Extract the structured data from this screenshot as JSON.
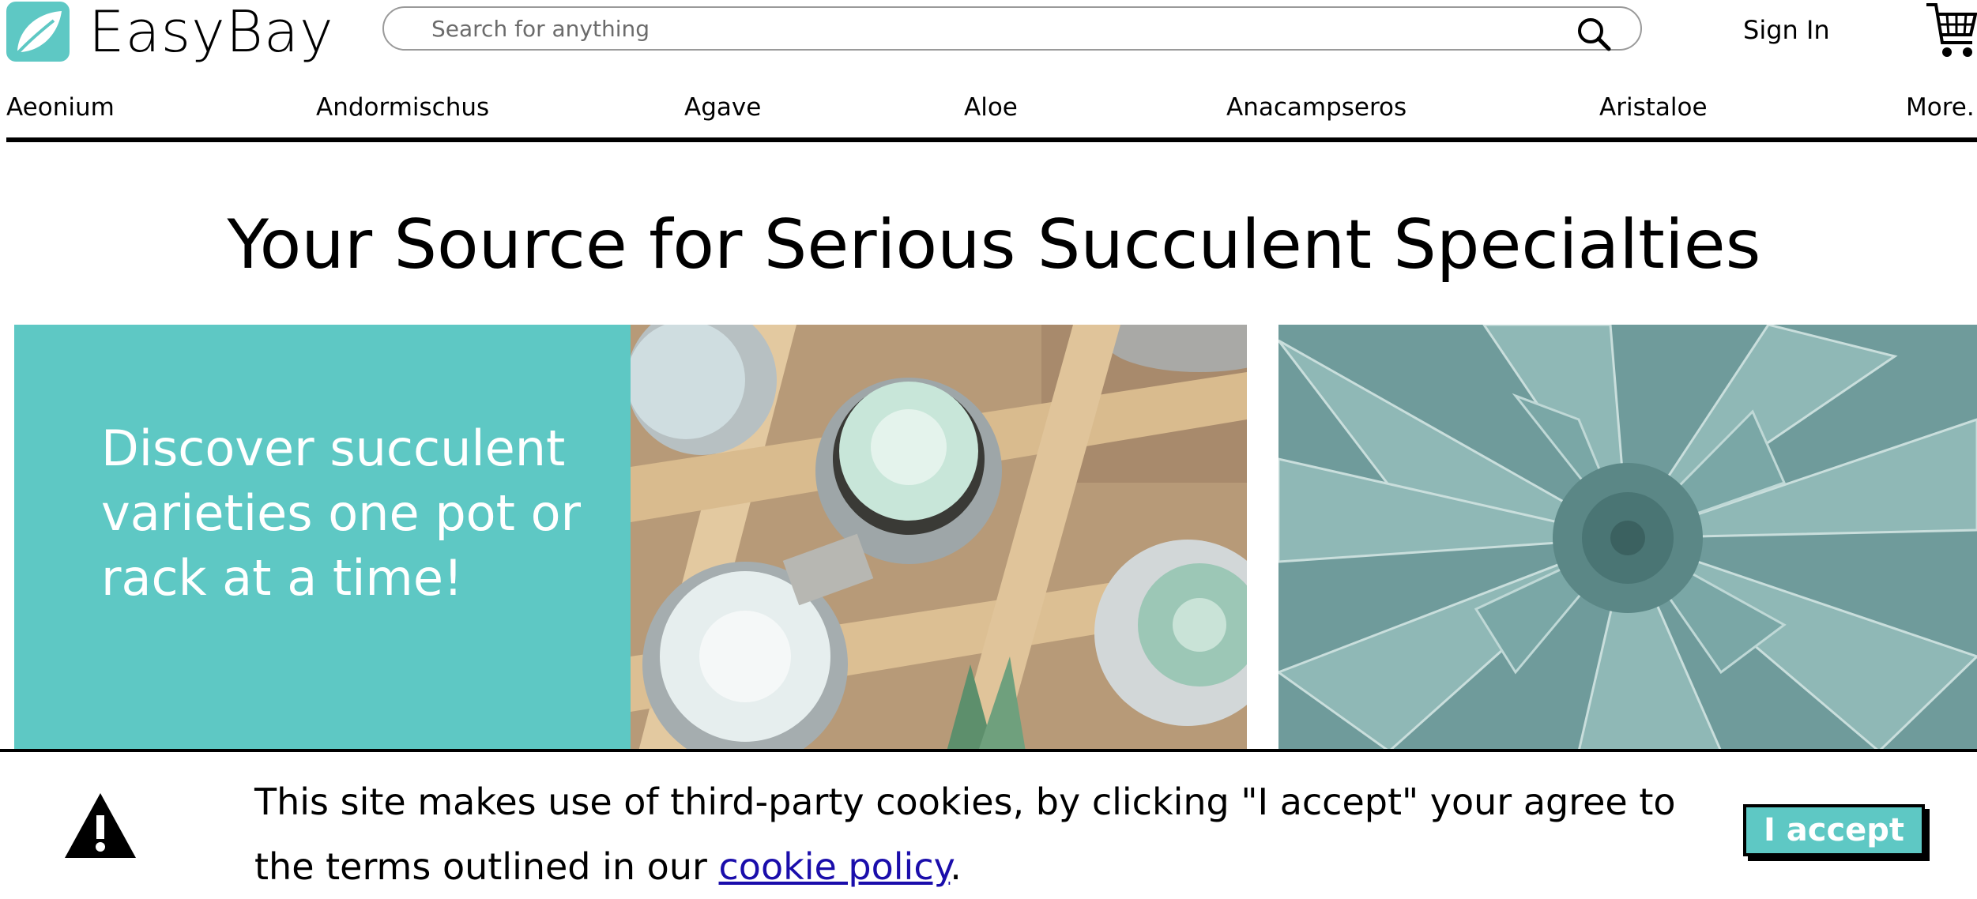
{
  "header": {
    "brand": "EasyBay",
    "search_placeholder": "Search for anything",
    "signin_label": "Sign In"
  },
  "nav": {
    "items": [
      "Aeonium",
      "Andormischus",
      "Agave",
      "Aloe",
      "Anacampseros",
      "Aristaloe",
      "More.."
    ]
  },
  "hero": {
    "headline": "Your Source for Serious Succulent Specialties",
    "promo_text": "Discover succulent varieties one pot or rack at a time!"
  },
  "cookie_banner": {
    "text_before": "This site makes use of third-party cookies, by clicking \"I accept\" your agree to the terms outlined in our ",
    "link_label": "cookie policy",
    "text_after": ".",
    "accept_label": "I accept"
  },
  "colors": {
    "accent": "#5ec8c4",
    "link": "#1a0dab",
    "text": "#000000"
  },
  "icons": [
    "leaf-logo-icon",
    "search-icon",
    "cart-icon",
    "warning-icon"
  ]
}
